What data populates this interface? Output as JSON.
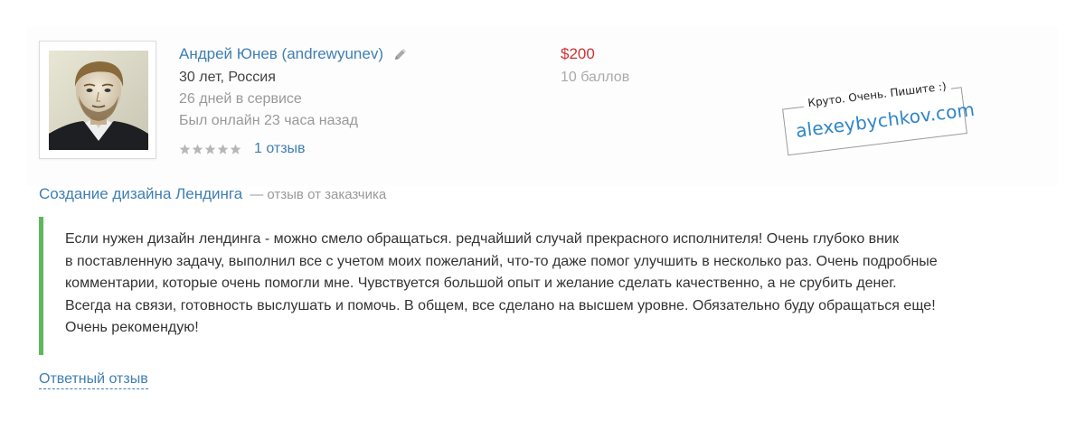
{
  "profile": {
    "name": "Андрей Юнев (andrewyunev)",
    "age_country": "30 лет, Россия",
    "days_in_service": "26 дней в сервисе",
    "last_online": "Был онлайн 23 часа назад",
    "rating_stars": 5,
    "reviews_link": "1 отзыв",
    "price": "$200",
    "points": "10 баллов"
  },
  "stamp": {
    "top_text": "Круто. Очень. Пишите :)",
    "main_text": "alexeybychkov.com"
  },
  "review": {
    "project_title": "Создание дизайна Лендинга",
    "project_note": "— отзыв от заказчика",
    "lines": [
      "Если нужен дизайн лендинга - можно смело обращаться. редчайший случай прекрасного исполнителя! Очень глубоко вник",
      "в поставленную задачу, выполнил все с учетом моих пожеланий, что-то даже помог улучшить в несколько раз. Очень подробные",
      "комментарии, которые очень помогли мне. Чувствуется большой опыт и желание сделать качественно, а не срубить денег.",
      "Всегда на связи, готовность выслушать и помочь. В общем, все сделано на высшем уровне. Обязательно буду обращаться еще!",
      "Очень рекомендую!"
    ],
    "reply_link": "Ответный отзыв"
  },
  "colors": {
    "link": "#3f7eb3",
    "price": "#cc3333",
    "accent_bar": "#5cb85c",
    "stamp_text": "#2e86c8"
  }
}
